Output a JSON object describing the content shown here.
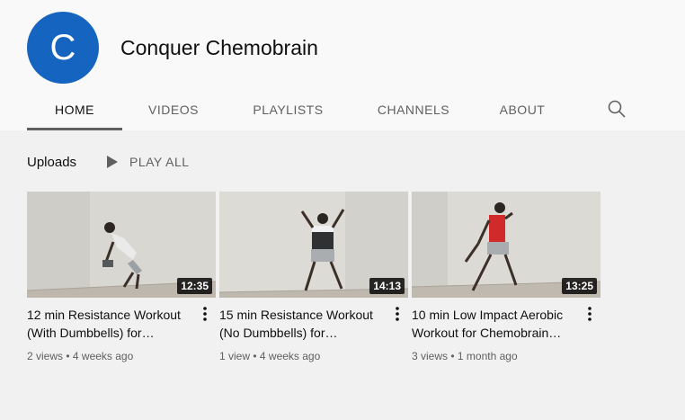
{
  "channel": {
    "avatar_letter": "C",
    "name": "Conquer Chemobrain"
  },
  "tabs": [
    {
      "label": "HOME",
      "active": true
    },
    {
      "label": "VIDEOS",
      "active": false
    },
    {
      "label": "PLAYLISTS",
      "active": false
    },
    {
      "label": "CHANNELS",
      "active": false
    },
    {
      "label": "ABOUT",
      "active": false
    }
  ],
  "uploads": {
    "title": "Uploads",
    "play_all": "PLAY ALL"
  },
  "videos": [
    {
      "title": "12 min Resistance Workout (With Dumbbells) for…",
      "duration": "12:35",
      "views": "2 views",
      "age": "4 weeks ago"
    },
    {
      "title": "15 min Resistance Workout (No Dumbbells) for…",
      "duration": "14:13",
      "views": "1 view",
      "age": "4 weeks ago"
    },
    {
      "title": "10 min Low Impact Aerobic Workout for Chemobrain…",
      "duration": "13:25",
      "views": "3 views",
      "age": "1 month ago"
    }
  ],
  "colors": {
    "avatar_bg": "#1565c0",
    "page_bg": "#f1f1f1",
    "header_bg": "#f9f9f9"
  }
}
